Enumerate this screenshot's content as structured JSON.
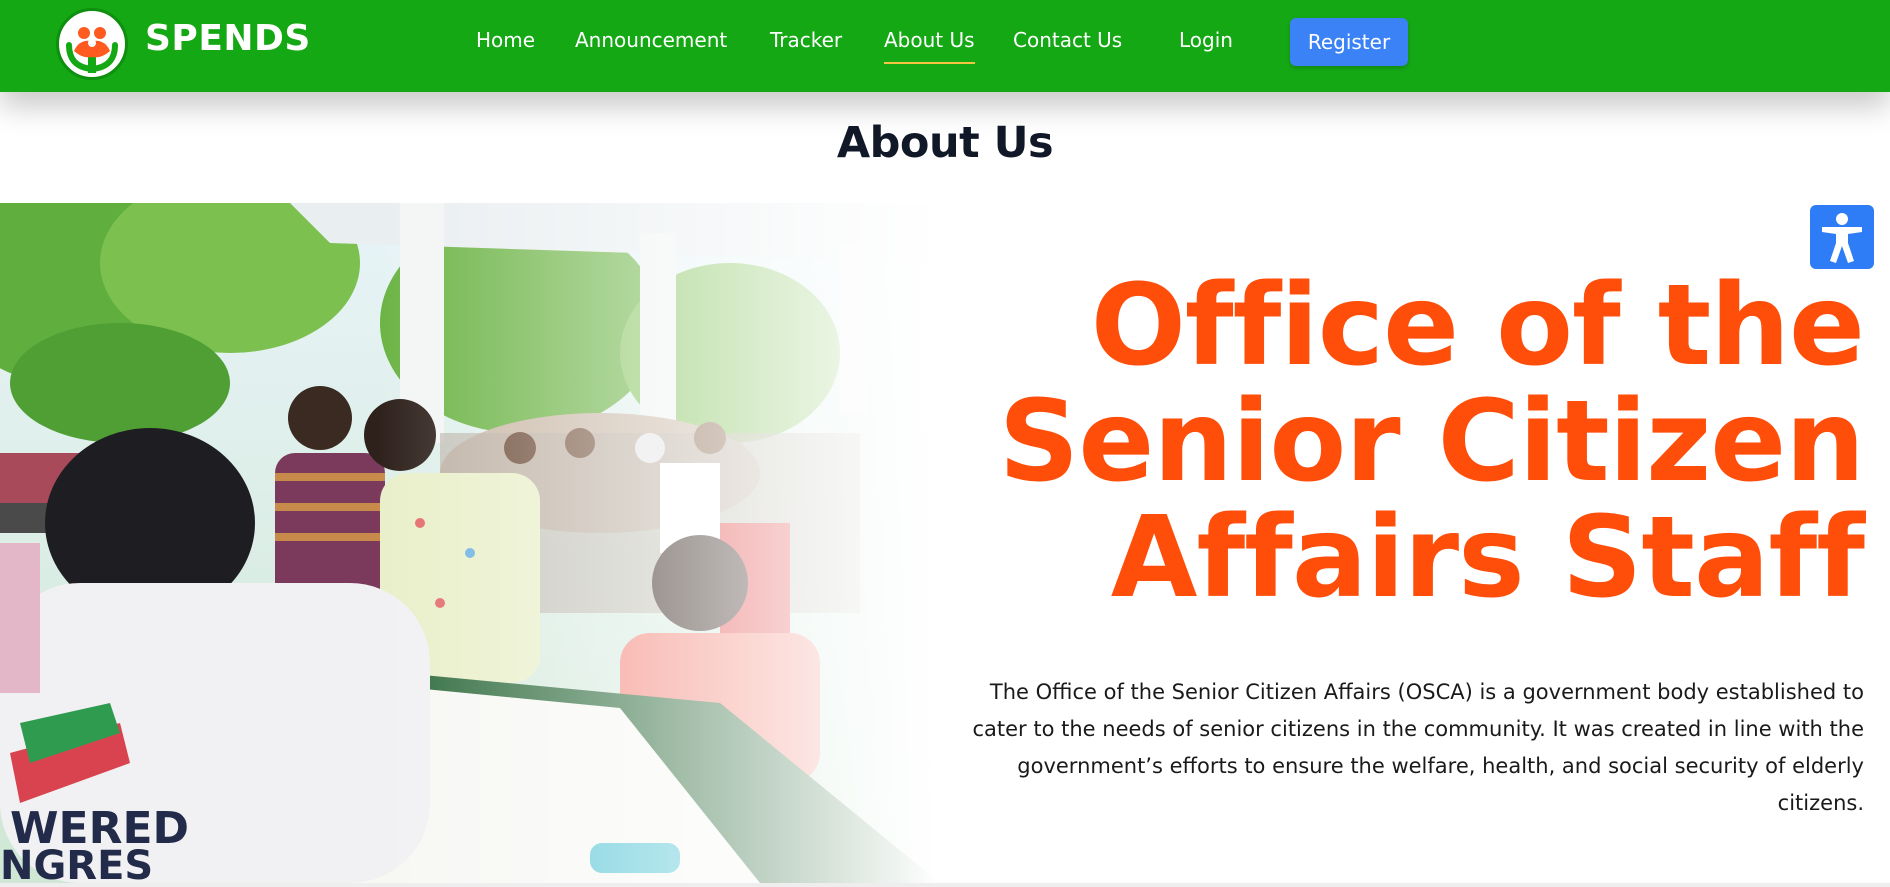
{
  "brand": {
    "name": "SPENDS",
    "logo": "hands-holding-family-icon"
  },
  "nav": {
    "items": [
      {
        "label": "Home",
        "active": false
      },
      {
        "label": "Announcement",
        "active": false
      },
      {
        "label": "Tracker",
        "active": false
      },
      {
        "label": "About Us",
        "active": true
      },
      {
        "label": "Contact Us",
        "active": false
      }
    ],
    "login_label": "Login",
    "register_label": "Register"
  },
  "page": {
    "title": "About Us",
    "headline": [
      "Office of the",
      "Senior Citizen",
      "Affairs Staff"
    ],
    "description": "The Office of the Senior Citizen Affairs (OSCA) is a government body established to cater to the needs of senior citizens in the community. It was created in line with the government’s efforts to ensure the welfare, health, and social security of elderly citizens."
  },
  "accessibility": {
    "icon": "accessibility-person-icon"
  },
  "colors": {
    "nav_bg": "#15a815",
    "headline": "#ff4d0a",
    "register_bg": "#3b82f6",
    "accessibility_bg": "#2e7cf6",
    "active_underline": "#f5c542",
    "title": "#111827"
  }
}
